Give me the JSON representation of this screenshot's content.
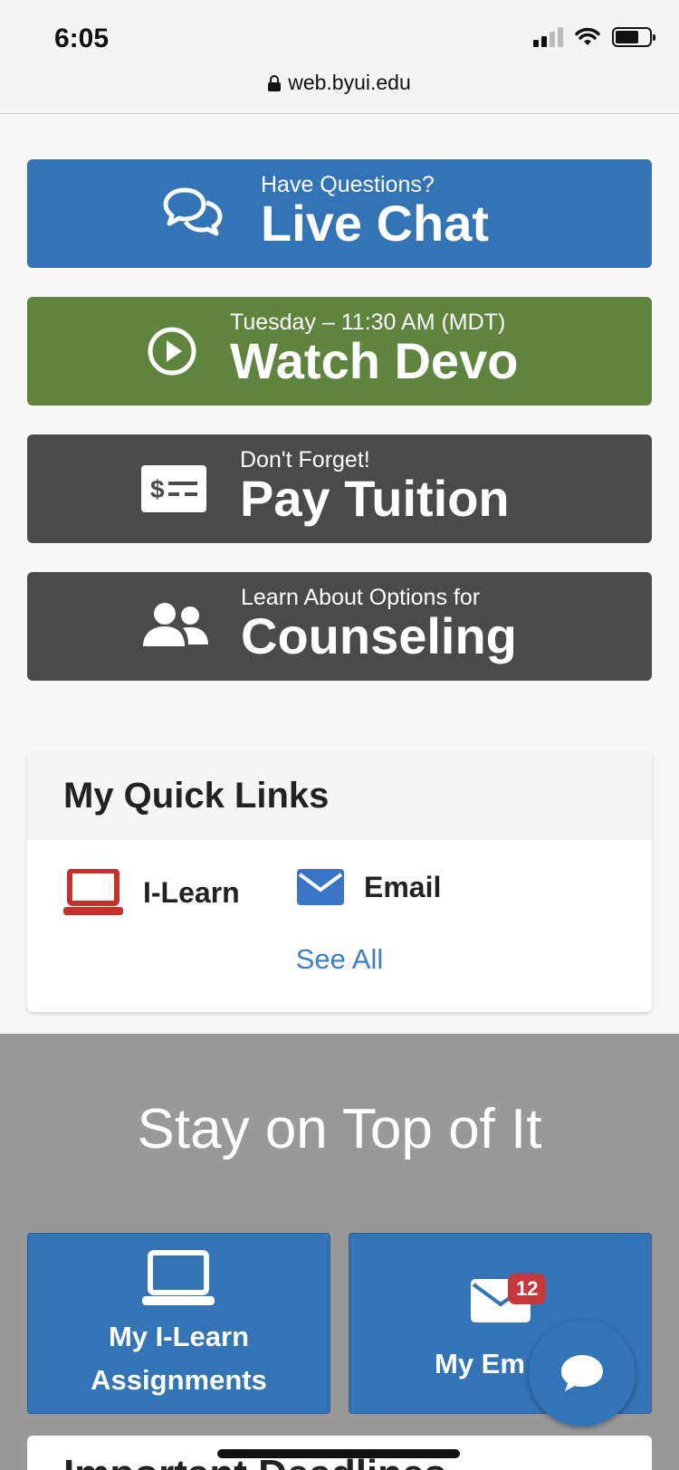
{
  "status_bar": {
    "time": "6:05",
    "url": "web.byui.edu"
  },
  "cta": {
    "live_chat": {
      "small": "Have Questions?",
      "big": "Live Chat",
      "color": "#3274b5"
    },
    "watch_devo": {
      "small": "Tuesday – 11:30 AM (MDT)",
      "big": "Watch Devo",
      "color": "#5f843d"
    },
    "pay_tuition": {
      "small": "Don't Forget!",
      "big": "Pay Tuition",
      "color": "#4a4a4a"
    },
    "counseling": {
      "small": "Learn About Options for",
      "big": "Counseling",
      "color": "#4a4a4a"
    }
  },
  "quick_links": {
    "title": "My Quick Links",
    "items": [
      {
        "label": "I-Learn",
        "icon": "laptop-icon",
        "color": "#c8302c"
      },
      {
        "label": "Email",
        "icon": "envelope-icon",
        "color": "#3a74c4"
      }
    ],
    "see_all": "See All"
  },
  "stay_section": {
    "title": "Stay on Top of It",
    "tiles": [
      {
        "line1": "My I-Learn",
        "line2": "Assignments",
        "icon": "laptop-icon"
      },
      {
        "line1": "My Em",
        "icon": "envelope-icon",
        "badge": "12"
      }
    ]
  },
  "bottom_card": {
    "title": "Important Deadlines"
  }
}
